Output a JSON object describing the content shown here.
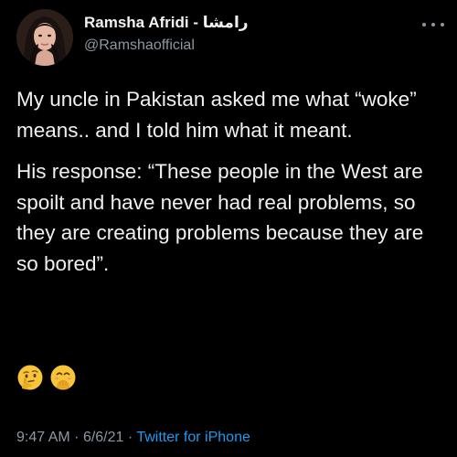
{
  "author": {
    "display_name": "Ramsha Afridi - رامشا",
    "handle": "@Ramshaofficial"
  },
  "tweet": {
    "paragraphs": [
      "My uncle in Pakistan asked me what “woke” means.. and I told him what it meant.",
      "His response: “These people in the West are spoilt and have never had real problems, so they are creating problems because they are so bored”."
    ],
    "emojis": [
      "thinking-face-emoji",
      "face-with-hand-over-mouth-emoji"
    ]
  },
  "meta": {
    "time": "9:47 AM",
    "separator": "·",
    "date": "6/6/21",
    "source": "Twitter for iPhone"
  },
  "colors": {
    "background": "#000000",
    "text": "#f0f0f0",
    "secondary": "#8b98a5",
    "link": "#1d9bf0",
    "emoji_yellow": "#f7c43a"
  }
}
